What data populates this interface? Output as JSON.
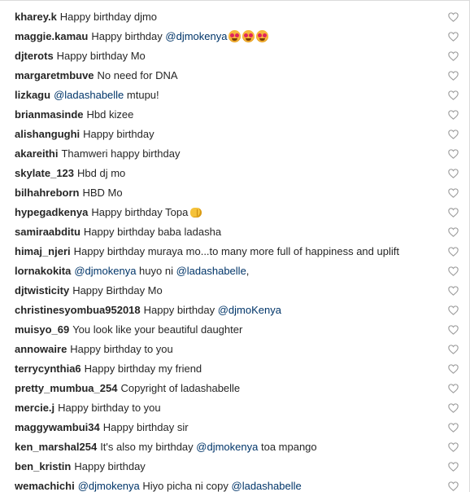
{
  "comments": [
    {
      "user": "kharey.k",
      "parts": [
        {
          "t": "Happy birthday djmo"
        }
      ]
    },
    {
      "user": "maggie.kamau",
      "parts": [
        {
          "t": "Happy birthday "
        },
        {
          "t": "@djmokenya",
          "m": true
        }
      ],
      "emoji": [
        "heart-eyes-emoji",
        "heart-eyes-emoji",
        "heart-eyes-emoji"
      ]
    },
    {
      "user": "djterots",
      "parts": [
        {
          "t": "Happy birthday Mo"
        }
      ]
    },
    {
      "user": "margaretmbuve",
      "parts": [
        {
          "t": "No need for DNA"
        }
      ]
    },
    {
      "user": "lizkagu",
      "parts": [
        {
          "t": "@ladashabelle",
          "m": true
        },
        {
          "t": " mtupu!"
        }
      ]
    },
    {
      "user": "brianmasinde",
      "parts": [
        {
          "t": "Hbd kizee"
        }
      ]
    },
    {
      "user": "alishangughi",
      "parts": [
        {
          "t": "Happy birthday"
        }
      ]
    },
    {
      "user": "akareithi",
      "parts": [
        {
          "t": "Thamweri happy birthday"
        }
      ]
    },
    {
      "user": "skylate_123",
      "parts": [
        {
          "t": "Hbd dj mo"
        }
      ]
    },
    {
      "user": "bilhahreborn",
      "parts": [
        {
          "t": "HBD Mo"
        }
      ]
    },
    {
      "user": "hypegadkenya",
      "parts": [
        {
          "t": "Happy birthday Topa"
        }
      ],
      "emoji": [
        "fist-emoji"
      ]
    },
    {
      "user": "samiraabditu",
      "parts": [
        {
          "t": "Happy birthday baba ladasha"
        }
      ]
    },
    {
      "user": "himaj_njeri",
      "parts": [
        {
          "t": "Happy birthday muraya mo...to many more full of happiness and uplift"
        }
      ]
    },
    {
      "user": "lornakokita",
      "parts": [
        {
          "t": "@djmokenya",
          "m": true
        },
        {
          "t": " huyo ni "
        },
        {
          "t": "@ladashabelle",
          "m": true
        },
        {
          "t": ","
        }
      ]
    },
    {
      "user": "djtwisticity",
      "parts": [
        {
          "t": "Happy Birthday Mo"
        }
      ]
    },
    {
      "user": "christinesyombua952018",
      "parts": [
        {
          "t": "Happy birthday "
        },
        {
          "t": "@djmoKenya",
          "m": true
        }
      ]
    },
    {
      "user": "muisyo_69",
      "parts": [
        {
          "t": "You look like your beautiful daughter"
        }
      ]
    },
    {
      "user": "annowaire",
      "parts": [
        {
          "t": "Happy birthday to you"
        }
      ]
    },
    {
      "user": "terrycynthia6",
      "parts": [
        {
          "t": "Happy birthday my friend"
        }
      ]
    },
    {
      "user": "pretty_mumbua_254",
      "parts": [
        {
          "t": "Copyright of ladashabelle"
        }
      ]
    },
    {
      "user": "mercie.j",
      "parts": [
        {
          "t": "Happy birthday to you"
        }
      ]
    },
    {
      "user": "maggywambui34",
      "parts": [
        {
          "t": "Happy birthday sir"
        }
      ]
    },
    {
      "user": "ken_marshal254",
      "parts": [
        {
          "t": "It's also my birthday "
        },
        {
          "t": "@djmokenya",
          "m": true
        },
        {
          "t": " toa mpango"
        }
      ]
    },
    {
      "user": "ben_kristin",
      "parts": [
        {
          "t": "Happy birthday"
        }
      ]
    },
    {
      "user": "wemachichi",
      "parts": [
        {
          "t": "@djmokenya",
          "m": true
        },
        {
          "t": " Hiyo picha ni copy "
        },
        {
          "t": "@ladashabelle",
          "m": true
        }
      ]
    }
  ],
  "like_icon": "heart-outline-icon",
  "colors": {
    "text": "#262626",
    "mention": "#003569",
    "icon": "#999999",
    "border": "#dbdbdb"
  }
}
